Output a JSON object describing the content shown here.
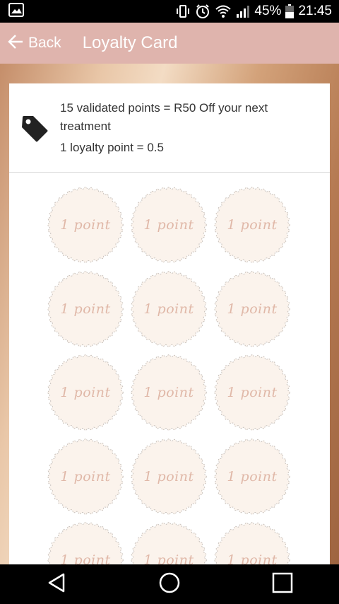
{
  "status_bar": {
    "battery": "45%",
    "time": "21:45",
    "icons": [
      "gallery-icon",
      "vibrate-icon",
      "alarm-icon",
      "wifi-icon",
      "signal-icon",
      "battery-icon"
    ]
  },
  "app_bar": {
    "back_label": "Back",
    "title": "Loyalty Card"
  },
  "info": {
    "icon": "tag-icon",
    "line1": "15 validated points = R50 Off your next treatment",
    "line2": "1 loyalty point = 0.5"
  },
  "stamps": {
    "label": "1 point",
    "count": 15,
    "fill_color": "#fbf3ec",
    "label_color": "#e0b8a8"
  },
  "nav_bar": {
    "icons": [
      "back-triangle-icon",
      "home-circle-icon",
      "recents-square-icon"
    ]
  },
  "colors": {
    "app_bar": "#dfb4ad",
    "backdrop_accent": "#c58e6a"
  }
}
